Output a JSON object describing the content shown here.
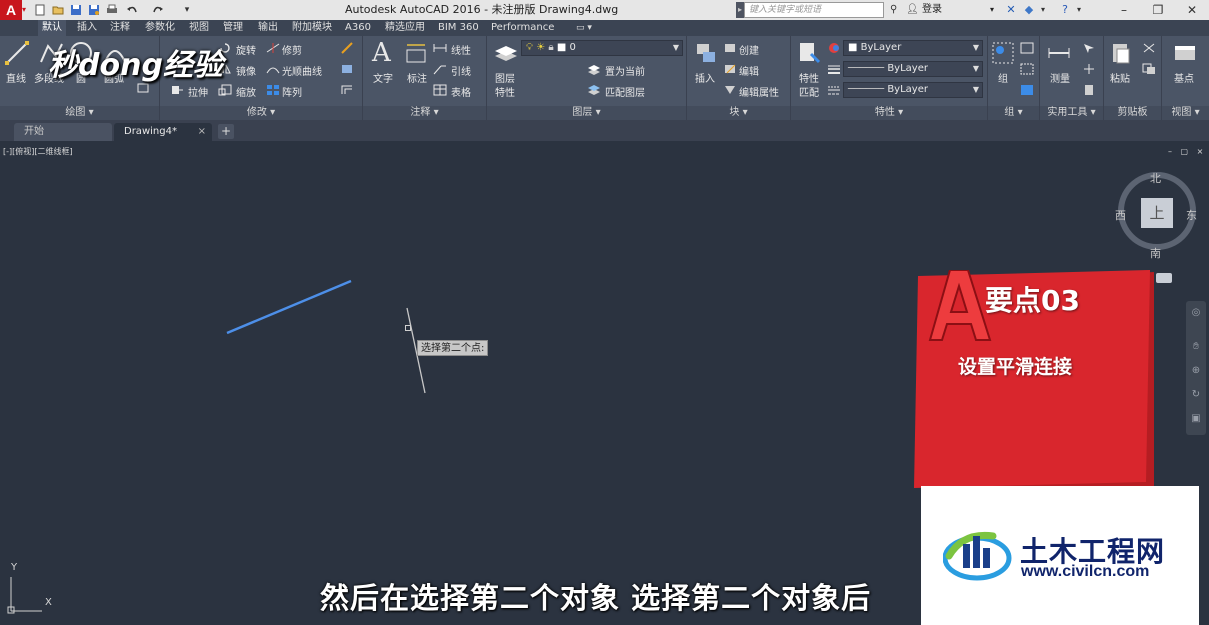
{
  "app": {
    "logo_letter": "A",
    "window_title": "Autodesk AutoCAD 2016 - 未注册版    Drawing4.dwg",
    "search_placeholder": "键入关键字或短语",
    "login_label": "登录"
  },
  "ribbon_tabs": [
    {
      "label": "默认",
      "active": true
    },
    {
      "label": "插入"
    },
    {
      "label": "注释"
    },
    {
      "label": "参数化"
    },
    {
      "label": "视图"
    },
    {
      "label": "管理"
    },
    {
      "label": "输出"
    },
    {
      "label": "附加模块"
    },
    {
      "label": "A360"
    },
    {
      "label": "精选应用"
    },
    {
      "label": "BIM 360"
    },
    {
      "label": "Performance"
    }
  ],
  "panels": {
    "draw": {
      "title": "绘图",
      "line": "直线",
      "polyline": "多段线",
      "circle": "圆",
      "arc": "圆弧"
    },
    "modify": {
      "title": "修改",
      "rotate": "旋转",
      "trim": "修剪",
      "mirror": "镜像",
      "fillet": "光顺曲线",
      "stretch": "拉伸",
      "scale": "缩放",
      "array": "阵列"
    },
    "annotation": {
      "title": "注释",
      "text": "文字",
      "dimension": "标注",
      "linear": "线性",
      "leader": "引线",
      "table": "表格"
    },
    "layers": {
      "title": "图层",
      "layer_props": "图层",
      "layer_props2": "特性",
      "layer_value": "0",
      "set_current": "置为当前",
      "match_layer": "匹配图层"
    },
    "block": {
      "title": "块",
      "insert": "插入",
      "create": "创建",
      "edit": "编辑",
      "edit_attr": "编辑属性"
    },
    "properties": {
      "title": "特性",
      "match": "特性",
      "match2": "匹配",
      "color": "ByLayer",
      "linetype": "ByLayer",
      "lineweight": "ByLayer"
    },
    "groups": {
      "title": "组",
      "group": "组"
    },
    "utilities": {
      "title": "实用工具",
      "measure": "测量"
    },
    "clipboard": {
      "title": "剪贴板",
      "paste": "粘贴"
    },
    "view": {
      "title": "视图",
      "base": "基点"
    }
  },
  "doc_tabs": {
    "start": "开始",
    "drawing": "Drawing4*",
    "new": "+",
    "close": "×"
  },
  "canvas": {
    "viewport_label": "[-][俯视][二维线框]",
    "viewport_controls": "– ▢ ×",
    "prompt": "选择第二个点:",
    "viewcube_top": "上",
    "compass_n": "北",
    "compass_s": "南",
    "compass_w": "西",
    "compass_e": "东",
    "ucs_x": "X",
    "ucs_y": "Y"
  },
  "overlay": {
    "keypoint_title": "要点03",
    "keypoint_desc": "设置平滑连接",
    "subtitle": "然后在选择第二个对象 选择第二个对象后",
    "watermark_top": "秒dong经验",
    "logo_name": "土木工程网",
    "logo_url": "www.civilcn.com"
  },
  "colors": {
    "canvas_bg": "#2b3340",
    "ribbon_bg": "#4b5566",
    "selected_line": "#4d8fe8",
    "card_red": "#d9262d",
    "logo_navy": "#10246b"
  }
}
